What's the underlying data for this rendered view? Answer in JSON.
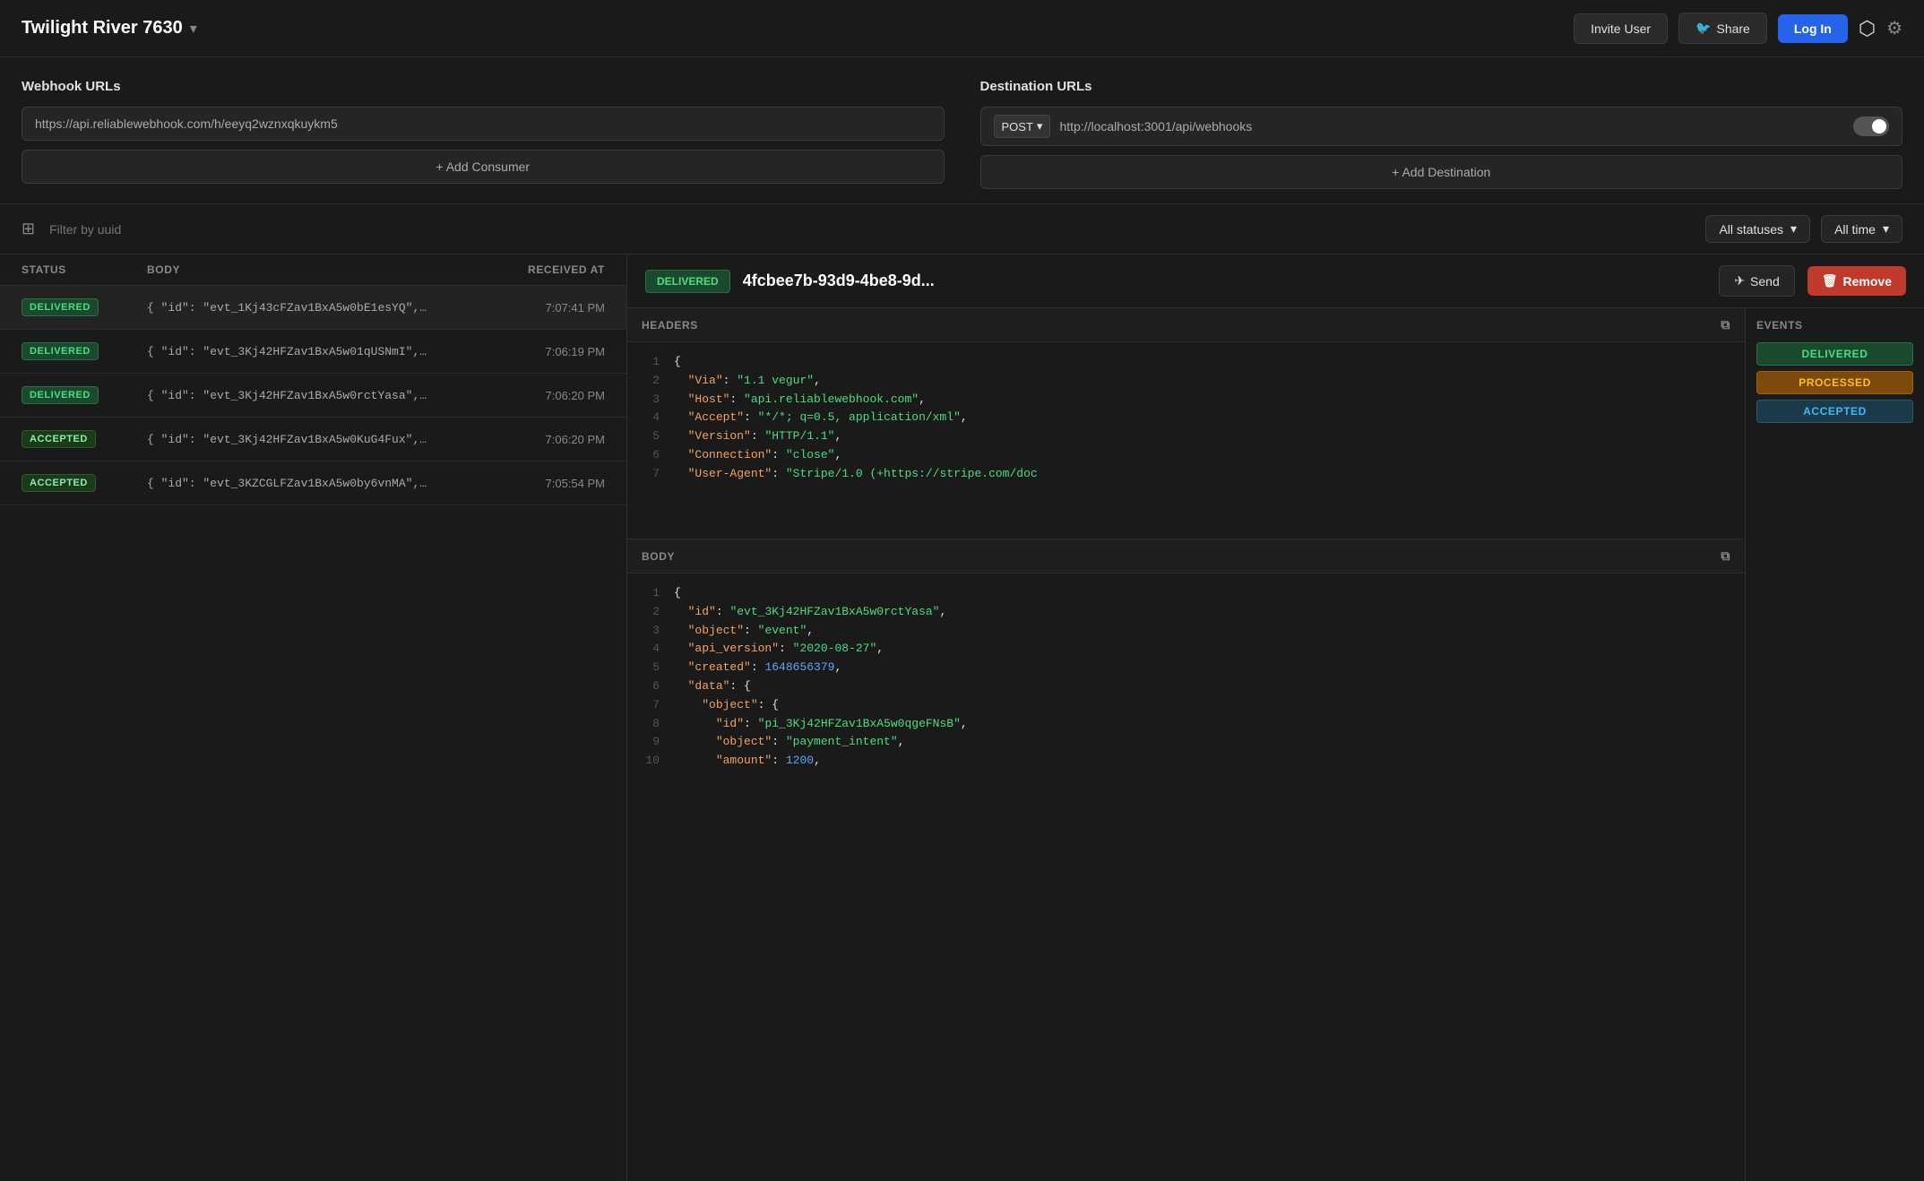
{
  "header": {
    "app_title": "Twilight River 7630",
    "chevron": "▾",
    "invite_label": "Invite User",
    "share_label": "Share",
    "login_label": "Log In",
    "github_icon": "⬡",
    "settings_icon": "✦"
  },
  "webhook_urls": {
    "title": "Webhook URLs",
    "url": "https://api.reliablewebhook.com/h/eeyq2wznxqkuykm5",
    "add_consumer_label": "+ Add Consumer"
  },
  "destination_urls": {
    "title": "Destination URLs",
    "method": "POST",
    "url": "http://localhost:3001/api/webhooks",
    "add_destination_label": "+ Add Destination"
  },
  "filter": {
    "placeholder": "Filter by uuid",
    "status_label": "All statuses",
    "time_label": "All time"
  },
  "table": {
    "columns": [
      "STATUS",
      "BODY",
      "RECEIVED AT"
    ],
    "rows": [
      {
        "status": "DELIVERED",
        "body": "{ \"id\": \"evt_1Kj43cFZav1BxA5w0bE1esYQ\",…",
        "time": "7:07:41 PM",
        "selected": true
      },
      {
        "status": "DELIVERED",
        "body": "{ \"id\": \"evt_3Kj42HFZav1BxA5w01qUSNmI\",…",
        "time": "7:06:19 PM",
        "selected": false
      },
      {
        "status": "DELIVERED",
        "body": "{ \"id\": \"evt_3Kj42HFZav1BxA5w0rctYasa\",…",
        "time": "7:06:20 PM",
        "selected": false
      },
      {
        "status": "ACCEPTED",
        "body": "{ \"id\": \"evt_3Kj42HFZav1BxA5w0KuG4Fux\",…",
        "time": "7:06:20 PM",
        "selected": false
      },
      {
        "status": "ACCEPTED",
        "body": "{ \"id\": \"evt_3KZCGLFZav1BxA5w0by6vnMA\",…",
        "time": "7:05:54 PM",
        "selected": false
      }
    ]
  },
  "detail": {
    "status": "DELIVERED",
    "event_id": "4fcbee7b-93d9-4be8-9d...",
    "send_label": "Send",
    "remove_label": "Remove",
    "headers_title": "HEADERS",
    "body_title": "BODY",
    "events_title": "EVENTS",
    "events": [
      "DELIVERED",
      "PROCESSED",
      "ACCEPTED"
    ],
    "headers_lines": [
      {
        "num": "1",
        "content": "{"
      },
      {
        "num": "2",
        "content": "  \"Via\": \"1.1 vegur\","
      },
      {
        "num": "3",
        "content": "  \"Host\": \"api.reliablewebhook.com\","
      },
      {
        "num": "4",
        "content": "  \"Accept\": \"*/*; q=0.5, application/xml\","
      },
      {
        "num": "5",
        "content": "  \"Version\": \"HTTP/1.1\","
      },
      {
        "num": "6",
        "content": "  \"Connection\": \"close\","
      },
      {
        "num": "7",
        "content": "  \"User-Agent\": \"Stripe/1.0 (+https://stripe.com/doc"
      }
    ],
    "body_lines": [
      {
        "num": "1",
        "content": "{"
      },
      {
        "num": "2",
        "content": "  \"id\": \"evt_3Kj42HFZav1BxA5w0rctYasa\","
      },
      {
        "num": "3",
        "content": "  \"object\": \"event\","
      },
      {
        "num": "4",
        "content": "  \"api_version\": \"2020-08-27\","
      },
      {
        "num": "5",
        "content": "  \"created\": 1648656379,"
      },
      {
        "num": "6",
        "content": "  \"data\": {"
      },
      {
        "num": "7",
        "content": "    \"object\": {"
      },
      {
        "num": "8",
        "content": "      \"id\": \"pi_3Kj42HFZav1BxA5w0qgeFNsB\","
      },
      {
        "num": "9",
        "content": "      \"object\": \"payment_intent\","
      },
      {
        "num": "10",
        "content": "      \"amount\": 1200,"
      }
    ]
  }
}
